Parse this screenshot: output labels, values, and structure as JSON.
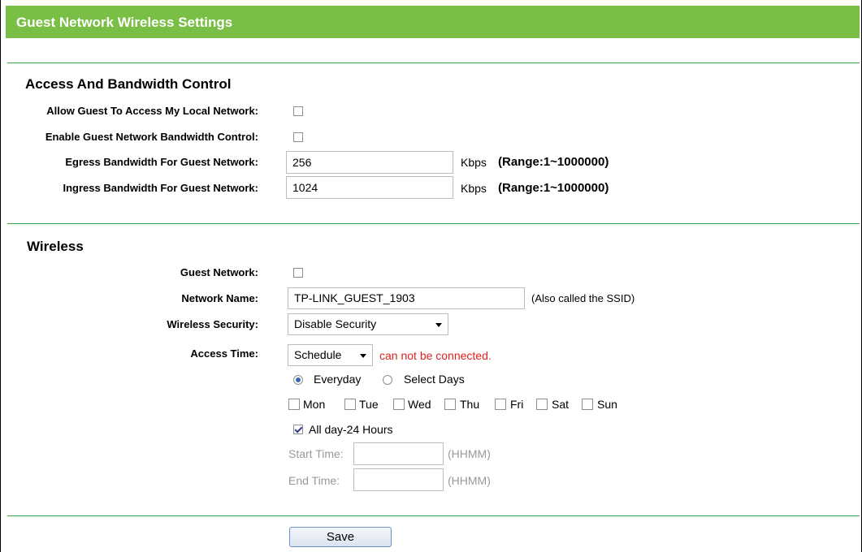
{
  "page_title": "Guest Network Wireless Settings",
  "access_section": {
    "title": "Access And Bandwidth Control",
    "allow_local_label": "Allow Guest To Access My Local Network:",
    "allow_local_checked": false,
    "bandwidth_control_label": "Enable Guest Network Bandwidth Control:",
    "bandwidth_control_checked": false,
    "egress_label": "Egress Bandwidth For Guest Network:",
    "egress_value": "256",
    "ingress_label": "Ingress Bandwidth For Guest Network:",
    "ingress_value": "1024",
    "unit": "Kbps",
    "range": "(Range:1~1000000)"
  },
  "wireless_section": {
    "title": "Wireless",
    "guest_network_label": "Guest Network:",
    "guest_network_checked": false,
    "network_name_label": "Network Name:",
    "network_name_value": "TP-LINK_GUEST_1903",
    "ssid_note": "(Also called the SSID)",
    "security_label": "Wireless Security:",
    "security_value": "Disable Security",
    "access_time_label": "Access Time:",
    "access_time_value": "Schedule",
    "status_text": "can not be connected.",
    "everyday_label": "Everyday",
    "select_days_label": "Select Days",
    "days": [
      "Mon",
      "Tue",
      "Wed",
      "Thu",
      "Fri",
      "Sat",
      "Sun"
    ],
    "all_day_label": "All day-24 Hours",
    "all_day_checked": true,
    "start_time_label": "Start Time:",
    "end_time_label": "End Time:",
    "time_format": "(HHMM)"
  },
  "save_label": "Save",
  "colors": {
    "title_bar": "#7abf45",
    "divider": "#39a54a",
    "status_red": "#e02020"
  }
}
